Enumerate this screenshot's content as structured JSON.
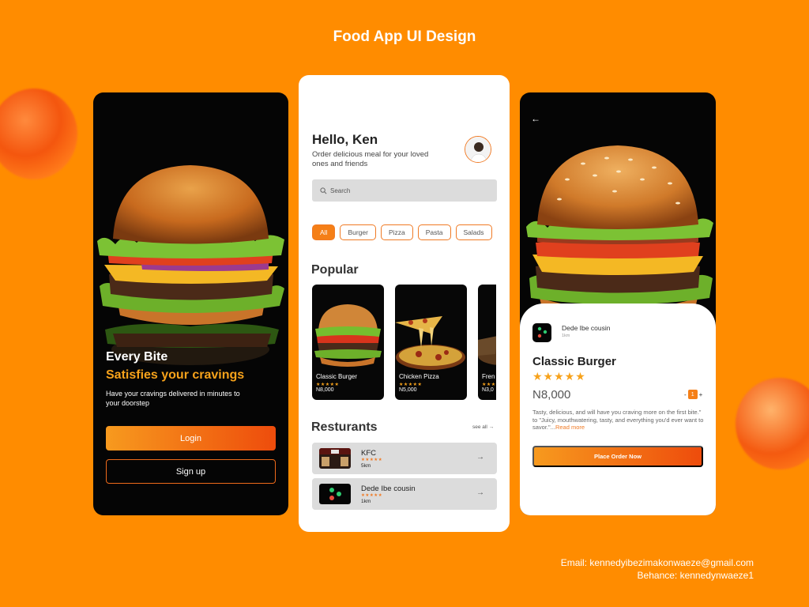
{
  "page": {
    "title": "Food App UI Design",
    "contact": {
      "email": "Email: kennedyibezimakonwaeze@gmail.com",
      "behance": "Behance: kennedynwaeze1"
    }
  },
  "colors": {
    "background": "#FF8C00",
    "accent": "#F57F17",
    "star": "#F7A21B",
    "dark": "#050505"
  },
  "onboarding": {
    "headline": "Every Bite",
    "subheadline": "Satisfies your cravings",
    "description": "Have your cravings delivered in minutes to your doorstep",
    "login_label": "Login",
    "signup_label": "Sign up"
  },
  "home": {
    "greeting": "Hello, Ken",
    "subtitle": "Order delicious meal for your loved ones and friends",
    "search_placeholder": "Search",
    "categories": [
      "All",
      "Burger",
      "Pizza",
      "Pasta",
      "Salads"
    ],
    "active_category": "All",
    "popular_title": "Popular",
    "popular": [
      {
        "name": "Classic Burger",
        "price": "N8,000",
        "rating": 5
      },
      {
        "name": "Chicken Pizza",
        "price": "N5,000",
        "rating": 5
      },
      {
        "name": "Fren",
        "price": "N3,0",
        "rating": 5
      }
    ],
    "restaurants_title": "Resturants",
    "see_all": "see all →",
    "restaurants": [
      {
        "name": "KFC",
        "distance": "5km",
        "rating": 5
      },
      {
        "name": "Dede Ibe cousin",
        "distance": "1km",
        "rating": 5
      }
    ]
  },
  "detail": {
    "back_icon": "arrow-left-icon",
    "restaurant_name": "Dede Ibe cousin",
    "restaurant_distance": "1km",
    "food_title": "Classic Burger",
    "stars": "★★★★★",
    "rating": 5,
    "price": "N8,000",
    "quantity": "1",
    "minus": "-",
    "plus": "+",
    "description": "Tasty, delicious, and will have you craving more on the first bite.\" to \"Juicy, mouthwatering, tasty, and everything you'd ever want to savor.\"...",
    "read_more": "Read more",
    "order_label": "Place Order Now"
  }
}
